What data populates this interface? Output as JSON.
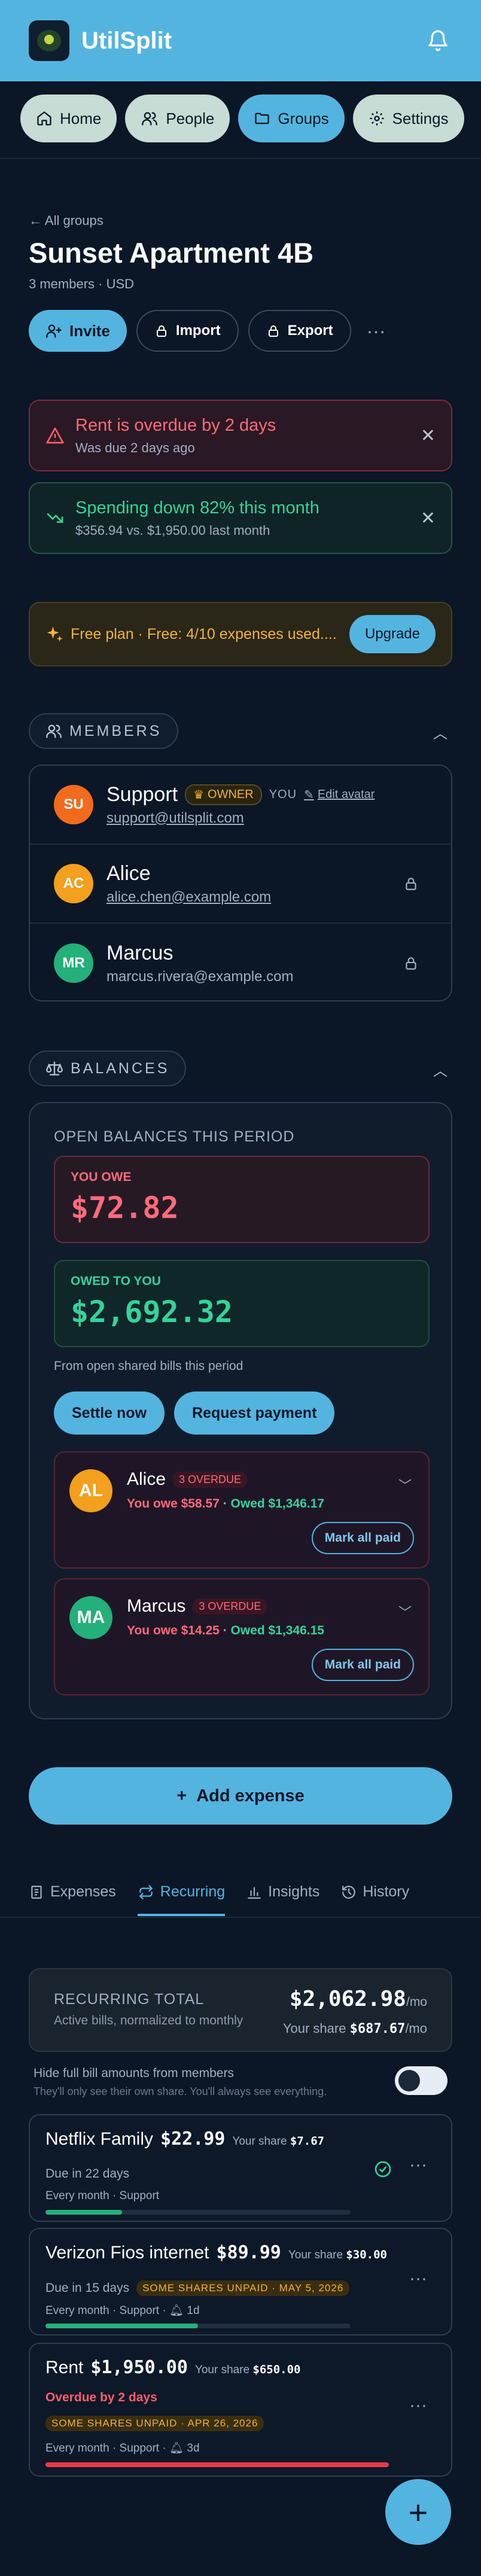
{
  "app": {
    "title": "UtilSplit"
  },
  "nav": {
    "home": "Home",
    "people": "People",
    "groups": "Groups",
    "settings": "Settings"
  },
  "group": {
    "back": "← All groups",
    "title": "Sunset Apartment 4B",
    "subtitle": "3 members · USD"
  },
  "actions": {
    "invite": "Invite",
    "import": "Import",
    "export": "Export",
    "more": "···"
  },
  "alerts": {
    "overdue": {
      "title": "Rent is overdue by 2 days",
      "sub": "Was due 2 days ago"
    },
    "spending": {
      "title": "Spending down 82% this month",
      "sub": "$356.94 vs. $1,950.00 last month"
    }
  },
  "plan": {
    "text": "Free plan · Free: 4/10 expenses used....",
    "upgrade": "Upgrade"
  },
  "members": {
    "header": "MEMBERS",
    "items": [
      {
        "initials": "SU",
        "name": "Support",
        "badge": "OWNER",
        "you": "YOU",
        "edit": "Edit avatar",
        "email": "support@utilsplit.com",
        "color": "#f26b1d"
      },
      {
        "initials": "AC",
        "name": "Alice",
        "email": "alice.chen@example.com",
        "color": "#f2a01d"
      },
      {
        "initials": "MR",
        "name": "Marcus",
        "email": "marcus.rivera@example.com",
        "color": "#23b07a"
      }
    ]
  },
  "balances": {
    "header": "BALANCES",
    "open_title": "OPEN BALANCES THIS PERIOD",
    "you_owe_label": "YOU OWE",
    "you_owe": "$72.82",
    "owed_label": "OWED TO YOU",
    "owed": "$2,692.32",
    "from": "From open shared bills this period",
    "settle": "Settle now",
    "request": "Request payment",
    "people": [
      {
        "initials": "AL",
        "name": "Alice",
        "overdue": "3 OVERDUE",
        "owe": "You owe $58.57",
        "owed": "Owed $1,346.17",
        "mark": "Mark all paid",
        "color": "#f2a01d"
      },
      {
        "initials": "MA",
        "name": "Marcus",
        "overdue": "3 OVERDUE",
        "owe": "You owe $14.25",
        "owed": "Owed $1,346.15",
        "mark": "Mark all paid",
        "color": "#23b07a"
      }
    ]
  },
  "add_expense": "Add expense",
  "tabs": {
    "expenses": "Expenses",
    "recurring": "Recurring",
    "insights": "Insights",
    "history": "History"
  },
  "recurring": {
    "title": "RECURRING TOTAL",
    "sub": "Active bills, normalized to monthly",
    "amount": "$2,062.98",
    "per": "/mo",
    "share_label": "Your share",
    "share": "$687.67",
    "share_per": "/mo",
    "hide_title": "Hide full bill amounts from members",
    "hide_sub": "They'll only see their own share. You'll always see everything."
  },
  "bills": [
    {
      "name": "Netflix Family",
      "amount": "$22.99",
      "share_label": "Your share",
      "share": "$7.67",
      "due": "Due in 22 days",
      "freq": "Every month · Support",
      "progress": 0.25,
      "color": "#23b07a"
    },
    {
      "name": "Verizon Fios internet",
      "amount": "$89.99",
      "share_label": "Your share",
      "share": "$30.00",
      "due": "Due in 15 days",
      "badge": "SOME SHARES UNPAID · MAY 5, 2026",
      "freq": "Every month · Support · ",
      "remind": "1d",
      "progress": 0.5,
      "color": "#23b07a"
    },
    {
      "name": "Rent",
      "amount": "$1,950.00",
      "share_label": "Your share",
      "share": "$650.00",
      "due": "Overdue by 2 days",
      "badge": "SOME SHARES UNPAID · APR 26, 2026",
      "freq": "Every month · Support · ",
      "remind": "3d",
      "progress": 1,
      "color": "#e8384a"
    }
  ]
}
